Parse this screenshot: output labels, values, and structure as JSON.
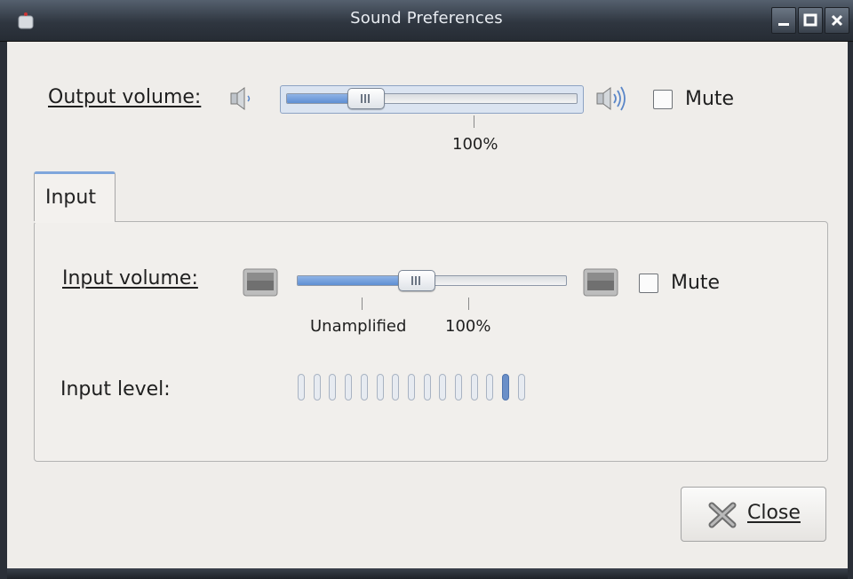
{
  "window": {
    "title": "Sound Preferences"
  },
  "output": {
    "label": "Output volume:",
    "volume_fraction": 0.27,
    "tick_label": "100%",
    "mute_label": "Mute",
    "muted": false
  },
  "tabs": [
    {
      "label": "Input",
      "active": true
    }
  ],
  "input": {
    "volume_label": "Input volume:",
    "volume_fraction": 0.44,
    "tick_unamplified": "Unamplified",
    "tick_100": "100%",
    "mute_label": "Mute",
    "muted": false,
    "level_label": "Input level:",
    "level_bars_total": 15,
    "level_active_index": 13
  },
  "buttons": {
    "close_label": "Close"
  },
  "colors": {
    "accent": "#7fa6dc",
    "slider_fill": "#5f8fd3"
  }
}
